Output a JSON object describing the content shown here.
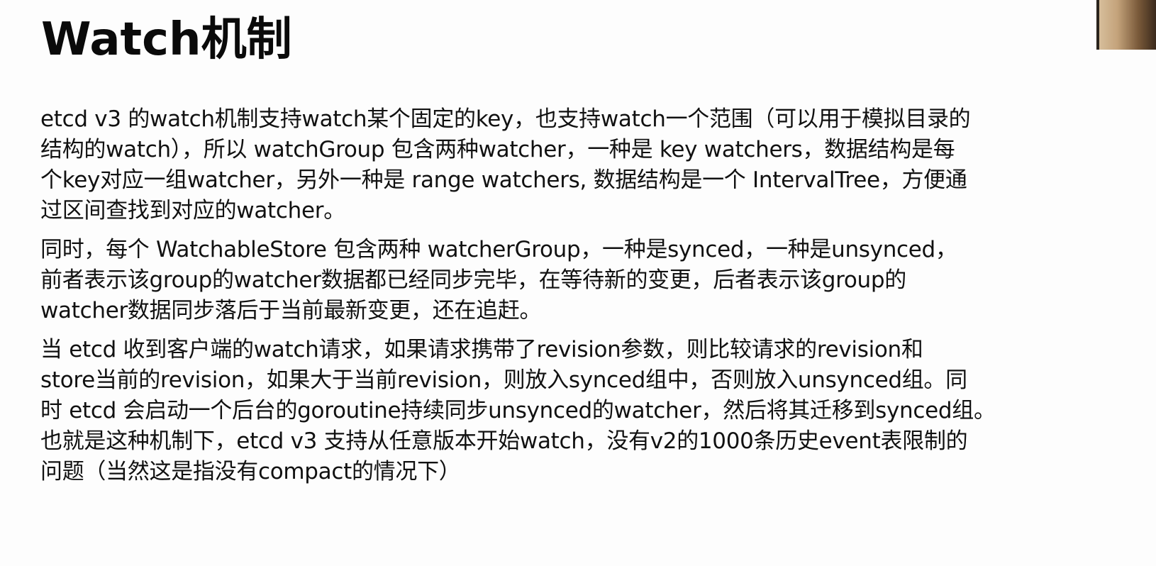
{
  "slide": {
    "title": "Watch机制",
    "paragraphs": [
      {
        "lines": [
          "etcd v3 的watch机制支持watch某个固定的key，也支持watch一个范围（可以用于模拟目录的",
          "结构的watch），所以 watchGroup 包含两种watcher，一种是 key watchers，数据结构是每",
          "个key对应一组watcher，另外一种是 range watchers, 数据结构是一个 IntervalTree，方便通",
          "过区间查找到对应的watcher。"
        ]
      },
      {
        "lines": [
          "同时，每个 WatchableStore 包含两种 watcherGroup，一种是synced，一种是unsynced，",
          "前者表示该group的watcher数据都已经同步完毕，在等待新的变更，后者表示该group的",
          "watcher数据同步落后于当前最新变更，还在追赶。"
        ]
      },
      {
        "lines": [
          "当 etcd 收到客户端的watch请求，如果请求携带了revision参数，则比较请求的revision和",
          "store当前的revision，如果大于当前revision，则放入synced组中，否则放入unsynced组。同",
          "时 etcd 会启动一个后台的goroutine持续同步unsynced的watcher，然后将其迁移到synced组。",
          "也就是这种机制下，etcd v3 支持从任意版本开始watch，没有v2的1000条历史event表限制的",
          "问题（当然这是指没有compact的情况下）"
        ]
      }
    ]
  },
  "overlay": {
    "icon": "webcam-thumbnail"
  }
}
